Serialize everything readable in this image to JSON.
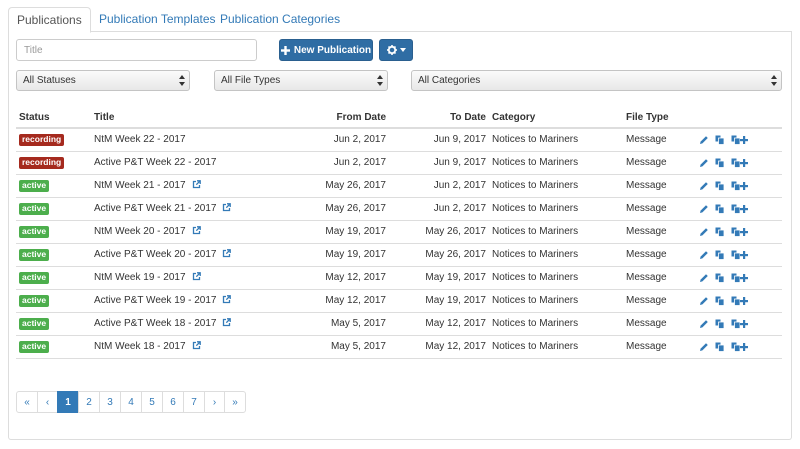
{
  "tabs": [
    {
      "label": "Publications",
      "active": true
    },
    {
      "label": "Publication Templates",
      "active": false
    },
    {
      "label": "Publication Categories",
      "active": false
    }
  ],
  "toolbar": {
    "title_placeholder": "Title",
    "new_button_label": "New Publication",
    "settings_icon": "gear-icon"
  },
  "filters": {
    "status": "All Statuses",
    "file_type": "All File Types",
    "category": "All Categories"
  },
  "table": {
    "columns": [
      "Status",
      "Title",
      "From Date",
      "To Date",
      "Category",
      "File Type"
    ],
    "rows": [
      {
        "status": "recording",
        "title": "NtM Week 22 - 2017",
        "external": false,
        "from": "Jun 2, 2017",
        "to": "Jun 9, 2017",
        "category": "Notices to Mariners",
        "file_type": "Message"
      },
      {
        "status": "recording",
        "title": "Active P&T Week 22 - 2017",
        "external": false,
        "from": "Jun 2, 2017",
        "to": "Jun 9, 2017",
        "category": "Notices to Mariners",
        "file_type": "Message"
      },
      {
        "status": "active",
        "title": "NtM Week 21 - 2017",
        "external": true,
        "from": "May 26, 2017",
        "to": "Jun 2, 2017",
        "category": "Notices to Mariners",
        "file_type": "Message"
      },
      {
        "status": "active",
        "title": "Active P&T Week 21 - 2017",
        "external": true,
        "from": "May 26, 2017",
        "to": "Jun 2, 2017",
        "category": "Notices to Mariners",
        "file_type": "Message"
      },
      {
        "status": "active",
        "title": "NtM Week 20 - 2017",
        "external": true,
        "from": "May 19, 2017",
        "to": "May 26, 2017",
        "category": "Notices to Mariners",
        "file_type": "Message"
      },
      {
        "status": "active",
        "title": "Active P&T Week 20 - 2017",
        "external": true,
        "from": "May 19, 2017",
        "to": "May 26, 2017",
        "category": "Notices to Mariners",
        "file_type": "Message"
      },
      {
        "status": "active",
        "title": "NtM Week 19 - 2017",
        "external": true,
        "from": "May 12, 2017",
        "to": "May 19, 2017",
        "category": "Notices to Mariners",
        "file_type": "Message"
      },
      {
        "status": "active",
        "title": "Active P&T Week 19 - 2017",
        "external": true,
        "from": "May 12, 2017",
        "to": "May 19, 2017",
        "category": "Notices to Mariners",
        "file_type": "Message"
      },
      {
        "status": "active",
        "title": "Active P&T Week 18 - 2017",
        "external": true,
        "from": "May 5, 2017",
        "to": "May 12, 2017",
        "category": "Notices to Mariners",
        "file_type": "Message"
      },
      {
        "status": "active",
        "title": "NtM Week 18 - 2017",
        "external": true,
        "from": "May 5, 2017",
        "to": "May 12, 2017",
        "category": "Notices to Mariners",
        "file_type": "Message"
      }
    ],
    "row_action_icons": [
      "pencil-icon",
      "copy-icon",
      "copy-add-icon"
    ]
  },
  "status_colors": {
    "recording": "#a52a1e",
    "active": "#4cae4c"
  },
  "colors": {
    "link": "#337ab7",
    "primary": "#2f6da4",
    "border": "#dddddd"
  },
  "pagination": {
    "first": "«",
    "prev": "‹",
    "next": "›",
    "last": "»",
    "pages": [
      "1",
      "2",
      "3",
      "4",
      "5",
      "6",
      "7"
    ],
    "current": "1"
  }
}
